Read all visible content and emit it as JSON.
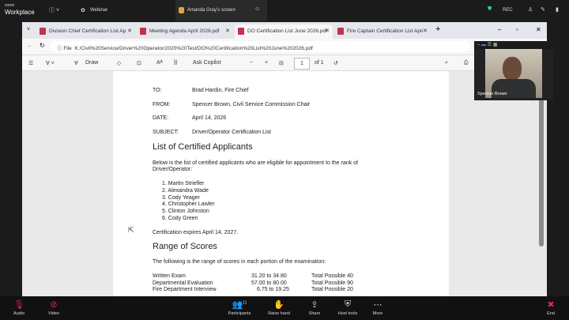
{
  "zoom": {
    "logo_small": "zoom",
    "logo": "Workplace",
    "webinar": "Webinar",
    "share_title": "Amanda Gray's screen",
    "rec": "REC"
  },
  "browser": {
    "tabs": [
      {
        "label": "Division Chief Certification List Ap"
      },
      {
        "label": "Meeting Agenda April 2026.pdf"
      },
      {
        "label": "DO Certification List June 2026.pdf",
        "active": true
      },
      {
        "label": "Fire Captain Certification List April"
      }
    ],
    "url_prefix": "File",
    "url": "K:/Civil%20Service/Driver%20Operator/2020%20Test/DO%20Certification%20List%20June%202026.pdf"
  },
  "pdf_toolbar": {
    "draw": "Draw",
    "ask_copilot": "Ask Copilot",
    "page": "1",
    "of": "of 1"
  },
  "document": {
    "memo": [
      {
        "label": "TO:",
        "value": "Brad Hardin, Fire Chief"
      },
      {
        "label": "FROM:",
        "value": "Spencer Brown, Civil Service Commission Chair"
      },
      {
        "label": "DATE:",
        "value": "April 14, 2026"
      },
      {
        "label": "SUBJECT:",
        "value": "Driver/Operator Certification List"
      }
    ],
    "heading1": "List of Certified Applicants",
    "intro1": "Below is the list of certified applicants who are eligible for appointment to the rank of",
    "intro2": "Driver/Operator:",
    "applicants": [
      "1.   Martin Striefler",
      "2.   Alexandra Wade",
      "3.   Cody Yeager",
      "4.   Christopher Lawler",
      "5.   Clinton Johnston",
      "6.   Cody Green"
    ],
    "expires": "Certification expires April 14, 2027.",
    "heading2": "Range of Scores",
    "intro3": "The following is the range of scores in each portion of the examination:",
    "scores": [
      {
        "portion": "Written Exam",
        "range": "31.20 to 34.80",
        "total": "Total Possible 40"
      },
      {
        "portion": "Departmental Evaluation",
        "range": "57.00 to 80.00",
        "total": "Total Possible 90"
      },
      {
        "portion": "Fire Department Interview",
        "range": "6.75 to 19.25",
        "total": "Total Possible 20"
      }
    ]
  },
  "video": {
    "name": "Spencer Brown"
  },
  "controls": {
    "audio": "Audio",
    "video": "Video",
    "participants": "Participants",
    "participants_count": "11",
    "raise_hand": "Raise hand",
    "share": "Share",
    "host_tools": "Host tools",
    "more": "More",
    "end": "End"
  }
}
